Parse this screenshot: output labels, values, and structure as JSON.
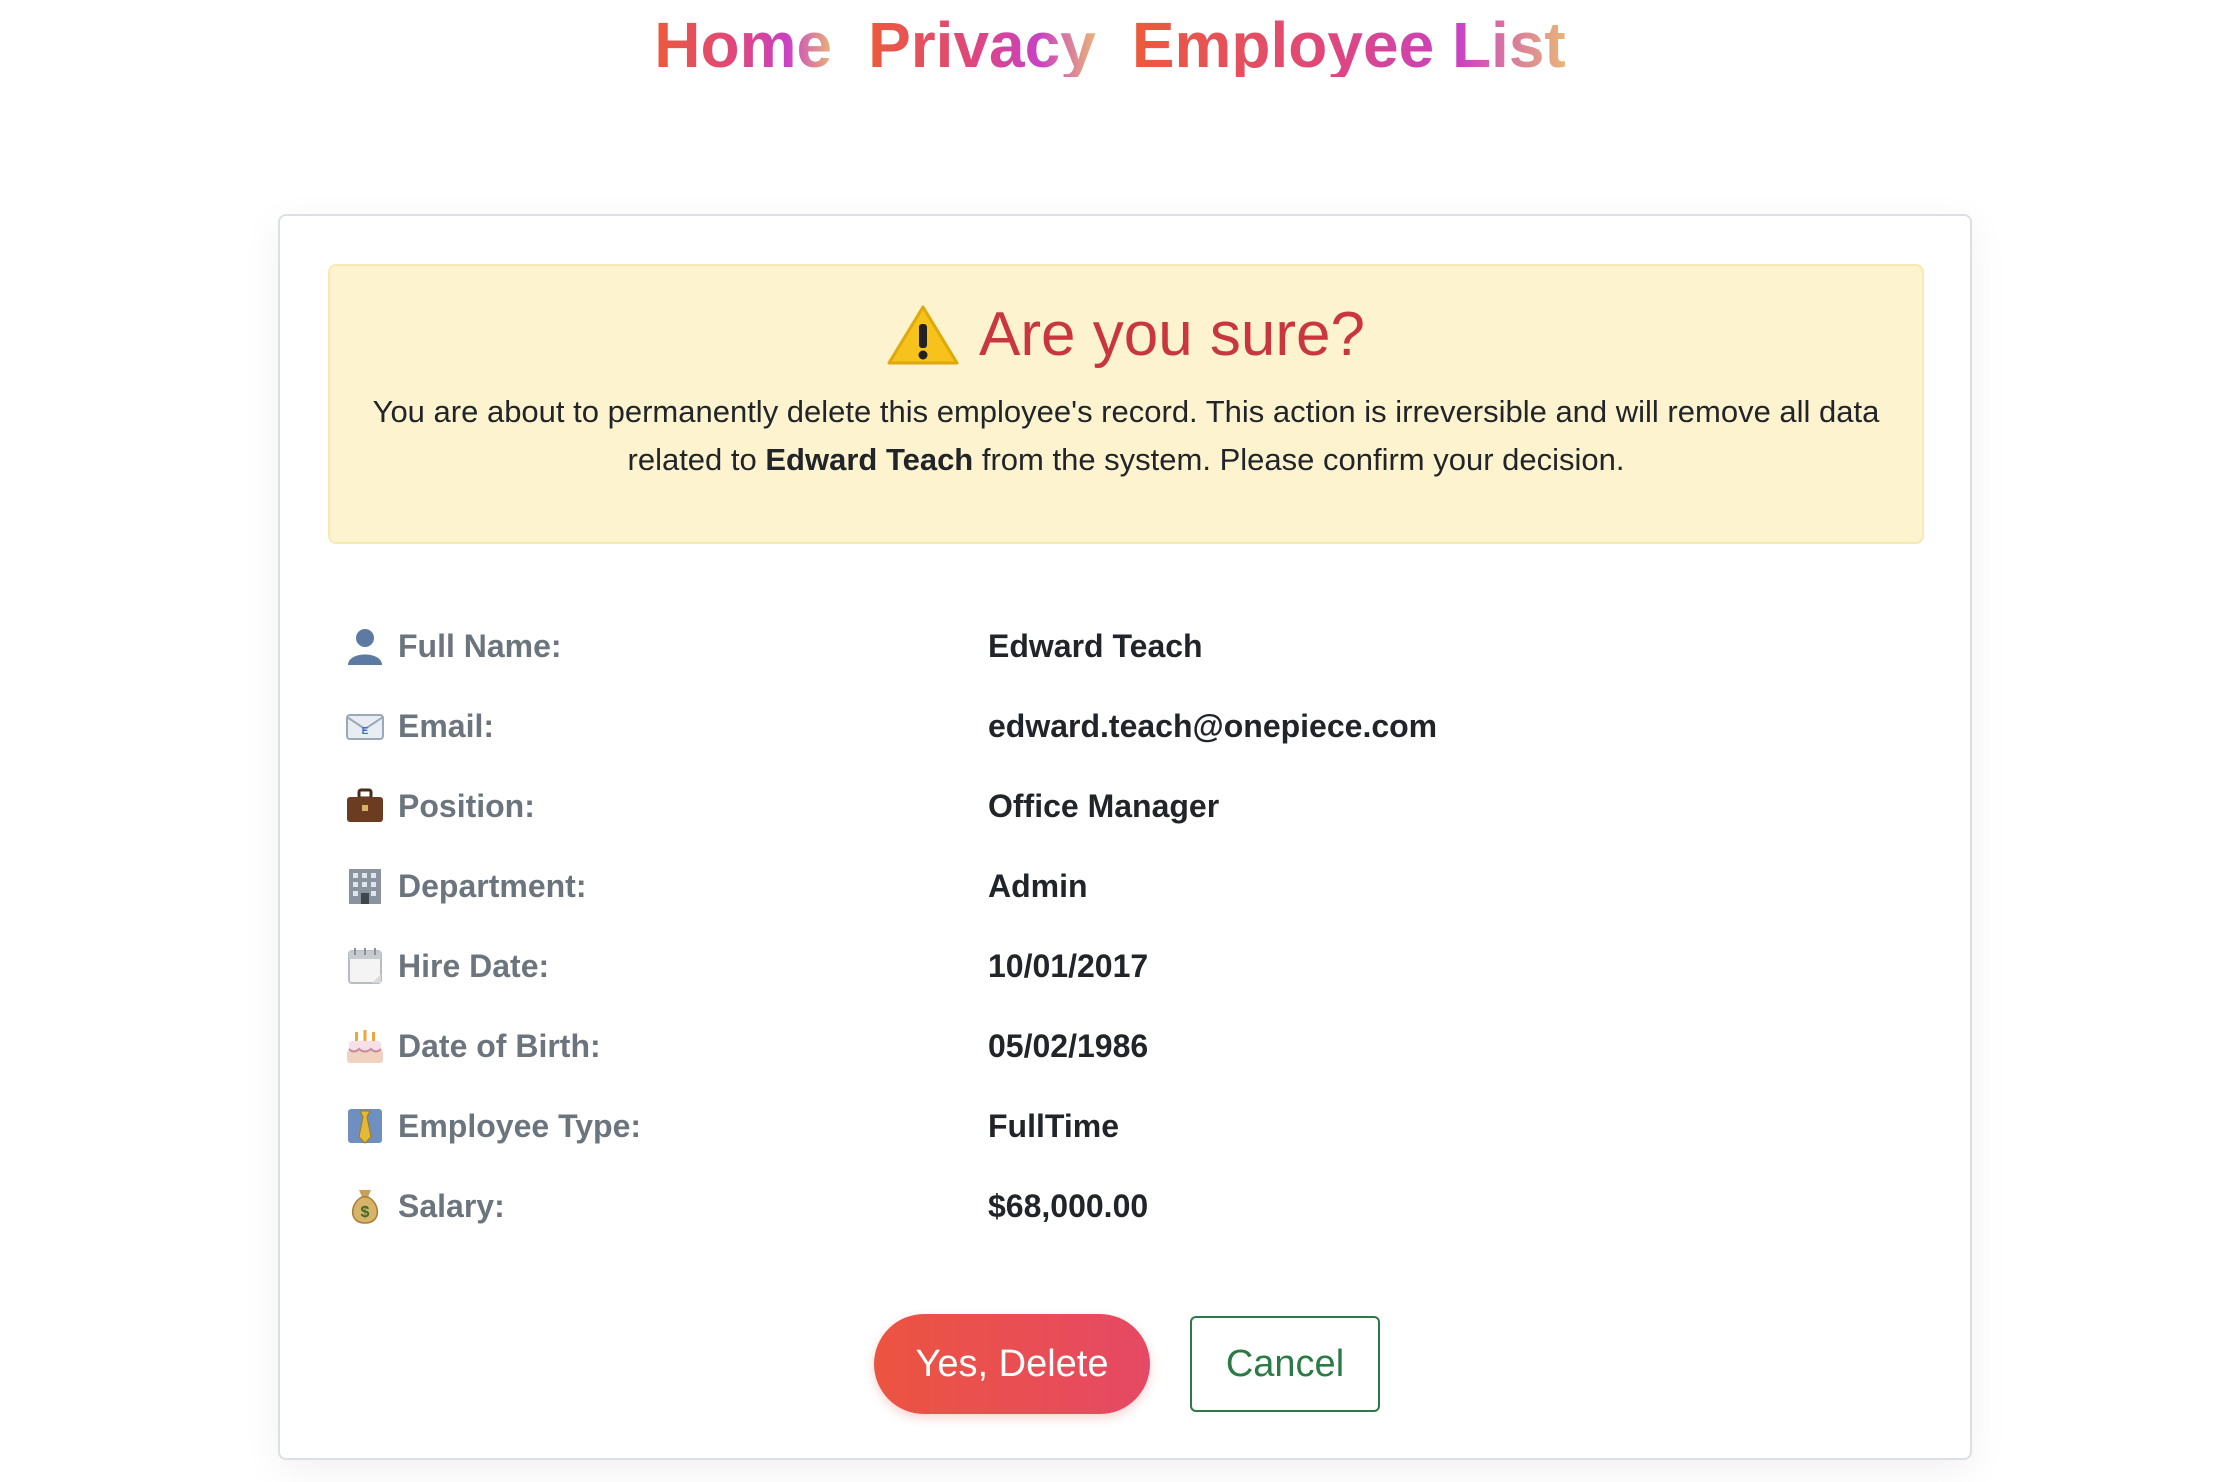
{
  "nav": {
    "links": [
      {
        "label": "Home"
      },
      {
        "label": "Privacy"
      },
      {
        "label": "Employee List"
      }
    ]
  },
  "alert": {
    "icon": "warning-icon",
    "heading": "Are you sure?",
    "body_before": "You are about to permanently delete this employee's record. This action is irreversible and will remove all data related to ",
    "body_name": "Edward Teach",
    "body_after": " from the system. Please confirm your decision.",
    "background": "#fdf3cf",
    "heading_color": "#c9363e"
  },
  "details": [
    {
      "icon": "person-icon",
      "label": "Full Name:",
      "value": "Edward Teach"
    },
    {
      "icon": "envelope-icon",
      "label": "Email:",
      "value": "edward.teach@onepiece.com"
    },
    {
      "icon": "briefcase-icon",
      "label": "Position:",
      "value": "Office Manager"
    },
    {
      "icon": "building-icon",
      "label": "Department:",
      "value": "Admin"
    },
    {
      "icon": "calendar-icon",
      "label": "Hire Date:",
      "value": "10/01/2017"
    },
    {
      "icon": "cake-icon",
      "label": "Date of Birth:",
      "value": "05/02/1986"
    },
    {
      "icon": "necktie-icon",
      "label": "Employee Type:",
      "value": "FullTime"
    },
    {
      "icon": "money-bag-icon",
      "label": "Salary:",
      "value": "$68,000.00"
    }
  ],
  "actions": {
    "delete_label": "Yes, Delete",
    "cancel_label": "Cancel",
    "delete_color": "#ec5440",
    "cancel_color": "#2c7a46"
  }
}
